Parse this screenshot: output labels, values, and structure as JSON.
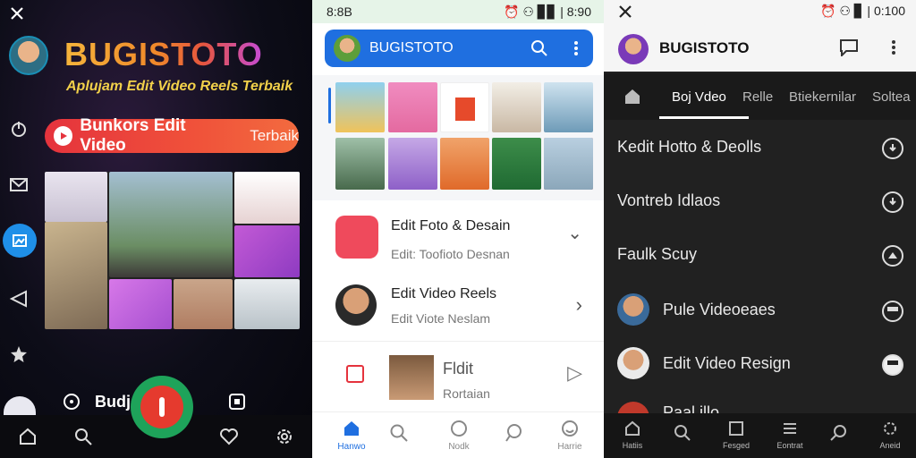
{
  "colors": {
    "accent_red": "#e5333d",
    "p2_blue": "#1f6fe0",
    "p3_dark": "#212121"
  },
  "panel1": {
    "title": "BUGISTOTO",
    "subtitle": "Aplujam Edit Video Reels Terbaik",
    "pill": {
      "primary": "Bunkors Edit Video",
      "secondary": "Terbaik"
    },
    "bottom_label": "Budjo",
    "side_icons": [
      "power-icon",
      "mail-icon",
      "image-icon",
      "send-icon",
      "star-icon",
      "chat-icon"
    ],
    "nav_icons": [
      "home-icon",
      "search-icon",
      "record-icon",
      "heart-icon",
      "settings-icon"
    ]
  },
  "panel2": {
    "status_left": "8:8B",
    "status_right": "⏰ ⚇ ▊▊ | 8:90",
    "appbar_title": "BUGISTOTO",
    "items": [
      {
        "title": "Edit Foto & Desain",
        "subtitle": "Edit: Toofioto Desnan",
        "chevron": "⌄"
      },
      {
        "title": "Edit Video Reels",
        "subtitle": "Edit Viote Neslam",
        "chevron": "›"
      },
      {
        "title": "Fldit",
        "subtitle": "Rortaian",
        "chevron": "▷"
      }
    ],
    "nav": [
      {
        "label": "Hanwo"
      },
      {
        "label": ""
      },
      {
        "label": "Nodk"
      },
      {
        "label": ""
      },
      {
        "label": "Harrie"
      }
    ]
  },
  "panel3": {
    "status_right": "⏰ ⚇ ▊ | 0:100",
    "appbar_title": "BUGISTOTO",
    "tabs": [
      "Boj Vdeo",
      "Relle",
      "Btiekernilar",
      "Soltea"
    ],
    "items": [
      "Kedit Hotto & Deolls",
      "Vontreb Idlaos",
      "Faulk Scuy",
      "Pule Videoeaes",
      "Edit Video Resign",
      "Paal illo"
    ],
    "nav": [
      {
        "label": "Hatiis"
      },
      {
        "label": ""
      },
      {
        "label": "Fesged"
      },
      {
        "label": "Eontrat"
      },
      {
        "label": ""
      },
      {
        "label": "Aneid"
      }
    ]
  }
}
